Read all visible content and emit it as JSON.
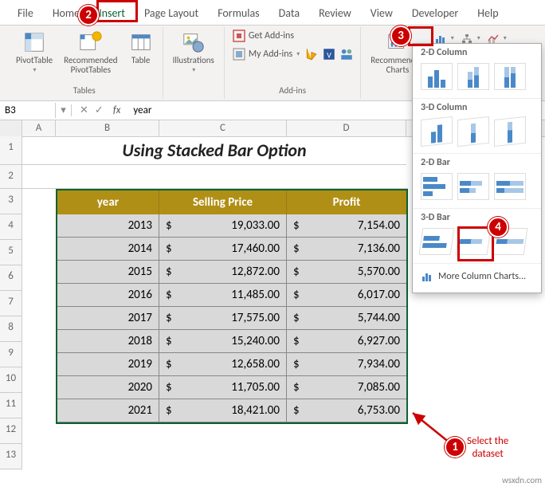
{
  "tabs": [
    "File",
    "Home",
    "Insert",
    "Page Layout",
    "Formulas",
    "Data",
    "Review",
    "View",
    "Developer",
    "Help"
  ],
  "active_tab": "Insert",
  "ribbon": {
    "tables": {
      "pivot": "PivotTable",
      "rec_pivot": "Recommended\nPivotTables",
      "table": "Table",
      "group": "Tables"
    },
    "illus": "Illustrations",
    "addins": {
      "get": "Get Add-ins",
      "my": "My Add-ins",
      "group": "Add-ins"
    },
    "charts": {
      "rec": "Recommended\nCharts"
    }
  },
  "namebox": "B3",
  "formula": "year",
  "title": "Using Stacked Bar Option",
  "headers": {
    "year": "year",
    "selling": "Selling Price",
    "profit": "Profit"
  },
  "rows": [
    {
      "year": "2013",
      "sell": "19,033.00",
      "profit": "7,154.00"
    },
    {
      "year": "2014",
      "sell": "17,460.00",
      "profit": "7,136.00"
    },
    {
      "year": "2015",
      "sell": "12,872.00",
      "profit": "5,570.00"
    },
    {
      "year": "2016",
      "sell": "11,485.00",
      "profit": "6,017.00"
    },
    {
      "year": "2017",
      "sell": "17,575.00",
      "profit": "5,744.00"
    },
    {
      "year": "2018",
      "sell": "15,240.00",
      "profit": "6,927.00"
    },
    {
      "year": "2019",
      "sell": "12,658.00",
      "profit": "7,934.00"
    },
    {
      "year": "2020",
      "sell": "11,705.00",
      "profit": "7,085.00"
    },
    {
      "year": "2021",
      "sell": "18,421.00",
      "profit": "6,753.00"
    }
  ],
  "dropdown": {
    "s1": "2-D Column",
    "s2": "3-D Column",
    "s3": "2-D Bar",
    "s4": "3-D Bar",
    "more": "More Column Charts..."
  },
  "callouts": {
    "c1": "1",
    "c2": "2",
    "c3": "3",
    "c4": "4",
    "sel": "Select the\ndataset"
  },
  "watermark": "wsxdn.com",
  "chart_data": {
    "type": "table",
    "title": "Using Stacked Bar Option",
    "columns": [
      "year",
      "Selling Price",
      "Profit"
    ],
    "series": [
      {
        "name": "Selling Price",
        "values": [
          19033,
          17460,
          12872,
          11485,
          17575,
          15240,
          12658,
          11705,
          18421
        ]
      },
      {
        "name": "Profit",
        "values": [
          7154,
          7136,
          5570,
          6017,
          5744,
          6927,
          7934,
          7085,
          6753
        ]
      }
    ],
    "categories": [
      "2013",
      "2014",
      "2015",
      "2016",
      "2017",
      "2018",
      "2019",
      "2020",
      "2021"
    ]
  }
}
